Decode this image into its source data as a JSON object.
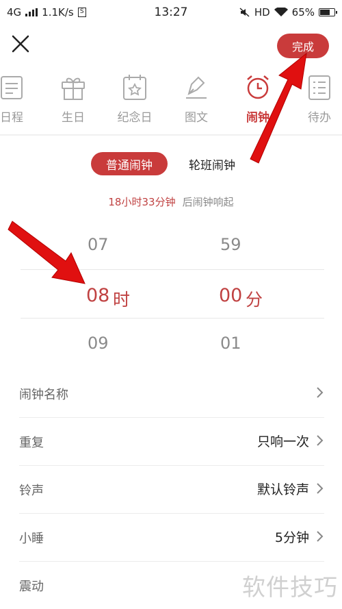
{
  "status_bar": {
    "network": "4G",
    "speed": "1.1K/s",
    "sim": "S",
    "time": "13:27",
    "hd": "HD",
    "battery": "65%"
  },
  "header": {
    "close_icon": "close-icon",
    "done_label": "完成"
  },
  "tabs": [
    {
      "label": "日程",
      "icon": "schedule-icon",
      "active": false
    },
    {
      "label": "生日",
      "icon": "gift-icon",
      "active": false
    },
    {
      "label": "纪念日",
      "icon": "anniversary-icon",
      "active": false
    },
    {
      "label": "图文",
      "icon": "pen-icon",
      "active": false
    },
    {
      "label": "闹钟",
      "icon": "alarm-clock-icon",
      "active": true
    },
    {
      "label": "待办",
      "icon": "todo-list-icon",
      "active": false
    }
  ],
  "alarm_type": {
    "selected": "普通闹钟",
    "other": "轮班闹钟"
  },
  "ring_info": {
    "time": "18小时33分钟",
    "suffix": "后闹钟响起"
  },
  "picker": {
    "hour_prev": "07",
    "hour": "08",
    "hour_unit": "时",
    "hour_next": "09",
    "minute_prev": "59",
    "minute": "00",
    "minute_unit": "分",
    "minute_next": "01"
  },
  "settings": [
    {
      "label": "闹钟名称",
      "value": ""
    },
    {
      "label": "重复",
      "value": "只响一次"
    },
    {
      "label": "铃声",
      "value": "默认铃声"
    },
    {
      "label": "小睡",
      "value": "5分钟"
    },
    {
      "label": "震动",
      "value": ""
    }
  ],
  "watermark": "软件技巧",
  "colors": {
    "accent": "#c93b3b",
    "arrow": "#e01010"
  }
}
